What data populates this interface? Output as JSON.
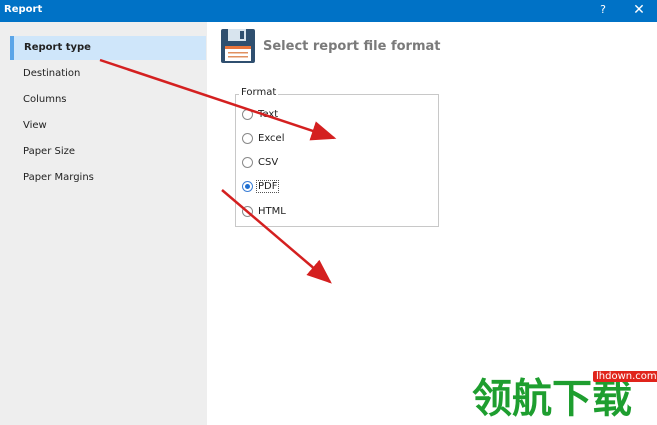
{
  "window": {
    "title": "Report",
    "help_glyph": "?",
    "close_glyph": "✕"
  },
  "sidebar": {
    "items": [
      {
        "label": "Report type",
        "selected": true
      },
      {
        "label": "Destination",
        "selected": false
      },
      {
        "label": "Columns",
        "selected": false
      },
      {
        "label": "View",
        "selected": false
      },
      {
        "label": "Paper Size",
        "selected": false
      },
      {
        "label": "Paper Margins",
        "selected": false
      }
    ]
  },
  "main": {
    "header_title": "Select report file format",
    "header_icon": "floppy-disk-icon",
    "format_group": {
      "legend": "Format",
      "options": [
        {
          "label": "Text",
          "checked": false
        },
        {
          "label": "Excel",
          "checked": false
        },
        {
          "label": "CSV",
          "checked": false
        },
        {
          "label": "PDF",
          "checked": true
        },
        {
          "label": "HTML",
          "checked": false
        }
      ]
    }
  },
  "annotation": {
    "arrow_color": "#d42020"
  },
  "watermark": {
    "url": "lhdown.com",
    "logo_text": "领航下载",
    "logo_color": "#1e9e2f"
  },
  "colors": {
    "titlebar": "#0072c6",
    "sidebar_bg": "#eeeeee",
    "selected_bg": "#cfe6fa",
    "selected_accent": "#5aa5e8"
  }
}
